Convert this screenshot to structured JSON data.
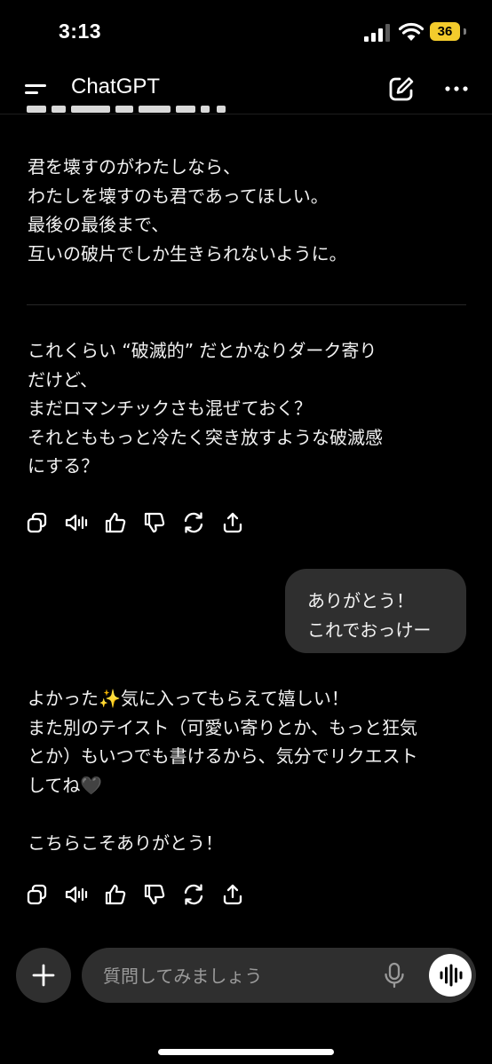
{
  "status_bar": {
    "time": "3:13",
    "battery": "36",
    "icons": [
      "signal-icon",
      "wifi-icon",
      "battery-icon"
    ]
  },
  "header": {
    "title": "ChatGPT",
    "icons": [
      "menu-icon",
      "new-chat-icon",
      "more-icon"
    ]
  },
  "conversation": {
    "assistant_message_1_lines": [
      "君を壊すのがわたしなら、",
      "わたしを壊すのも君であってほしい。",
      "最後の最後まで、",
      "互いの破片でしか生きられないように。"
    ],
    "assistant_message_2_lines": [
      "これくらい “破滅的” だとかなりダーク寄り",
      "だけど、",
      "まだロマンチックさも混ぜておく？",
      "それとももっと冷たく突き放すような破滅感",
      "にする？"
    ],
    "user_message_lines": [
      "ありがとう！",
      "これでおっけー"
    ],
    "assistant_message_3_lines": [
      "よかった✨気に入ってもらえて嬉しい！",
      "また別のテイスト（可愛い寄りとか、もっと狂気",
      "とか）もいつでも書けるから、気分でリクエスト",
      "してね🖤",
      "",
      "こちらこそありがとう！"
    ],
    "message_actions": [
      "copy-icon",
      "read-aloud-icon",
      "thumbs-up-icon",
      "thumbs-down-icon",
      "regenerate-icon",
      "share-icon"
    ]
  },
  "composer": {
    "placeholder": "質問してみましょう",
    "icons": [
      "plus-icon",
      "mic-icon",
      "voice-mode-icon"
    ]
  },
  "colors": {
    "background": "#000000",
    "bubble": "#2f2f2f",
    "battery": "#f3cb2c"
  }
}
